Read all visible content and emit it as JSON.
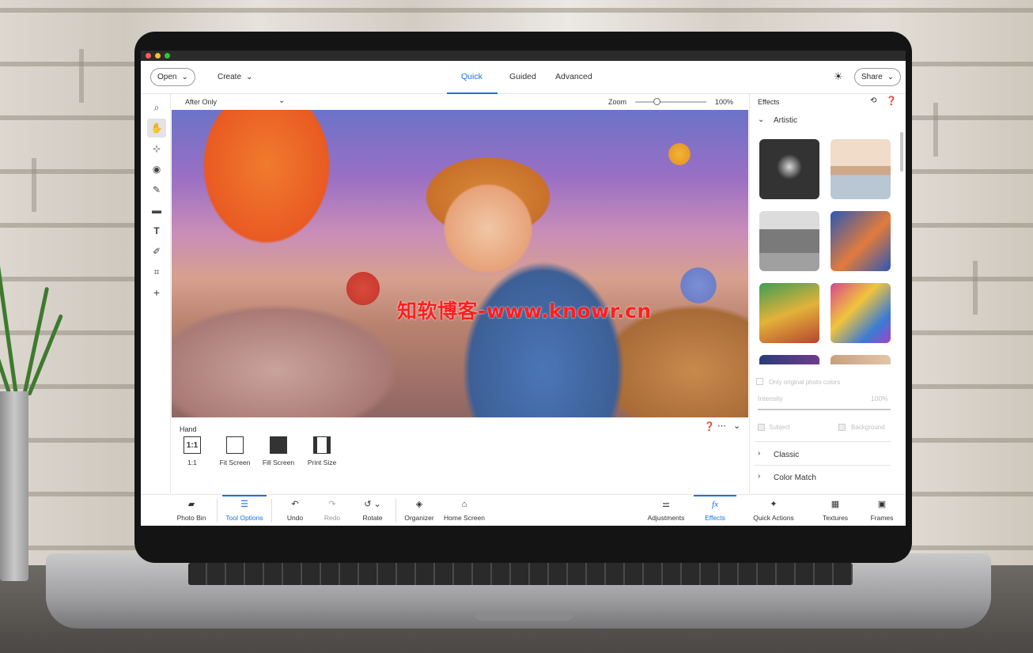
{
  "watermark": "知软博客-www.knowr.cn",
  "topbar": {
    "open_label": "Open",
    "create_label": "Create",
    "tabs": [
      {
        "label": "Quick",
        "active": true
      },
      {
        "label": "Guided",
        "active": false
      },
      {
        "label": "Advanced",
        "active": false
      }
    ],
    "share_label": "Share",
    "theme_icon": "sun-icon"
  },
  "left_tools": [
    "zoom-icon",
    "hand-icon",
    "quick-selection-icon",
    "eye-icon",
    "brush-icon",
    "eraser-icon",
    "text-icon",
    "healing-icon",
    "crop-icon",
    "move-icon"
  ],
  "options_bar": {
    "view_mode": "After Only",
    "zoom_label": "Zoom",
    "zoom_value": "100%",
    "zoom_level": 0.3
  },
  "tool_options": {
    "tool_name": "Hand",
    "buttons": [
      {
        "label": "1:1",
        "icon": "1:1"
      },
      {
        "label": "Fit Screen",
        "icon": ""
      },
      {
        "label": "Fill Screen",
        "icon": ""
      },
      {
        "label": "Print Size",
        "icon": ""
      }
    ]
  },
  "effects_panel": {
    "title": "Effects",
    "section_artistic": "Artistic",
    "checkbox_label": "Only original photo colors",
    "intensity_label": "Intensity",
    "intensity_value": "100%",
    "intensity_level": 1.0,
    "subject_label": "Subject",
    "background_label": "Background",
    "section_classic": "Classic",
    "section_color_match": "Color Match"
  },
  "bottom_bar": {
    "left": [
      {
        "label": "Photo Bin",
        "icon": "photo-bin-icon",
        "glyph": "▰"
      },
      {
        "label": "Tool Options",
        "icon": "tool-options-icon",
        "glyph": "☰",
        "active": true
      },
      {
        "label": "Undo",
        "icon": "undo-icon",
        "glyph": "↶"
      },
      {
        "label": "Redo",
        "icon": "redo-icon",
        "glyph": "↷"
      },
      {
        "label": "Rotate",
        "icon": "rotate-icon",
        "glyph": "↺ ⌄"
      },
      {
        "label": "Organizer",
        "icon": "organizer-icon",
        "glyph": "◈"
      },
      {
        "label": "Home Screen",
        "icon": "home-icon",
        "glyph": "⌂"
      }
    ],
    "right": [
      {
        "label": "Adjustments",
        "icon": "adjustments-icon",
        "glyph": "⚌"
      },
      {
        "label": "Effects",
        "icon": "effects-icon",
        "glyph": "fx",
        "active": true
      },
      {
        "label": "Quick Actions",
        "icon": "quick-actions-icon",
        "glyph": "✦"
      },
      {
        "label": "Textures",
        "icon": "textures-icon",
        "glyph": "▦"
      },
      {
        "label": "Frames",
        "icon": "frames-icon",
        "glyph": "▣"
      }
    ]
  }
}
